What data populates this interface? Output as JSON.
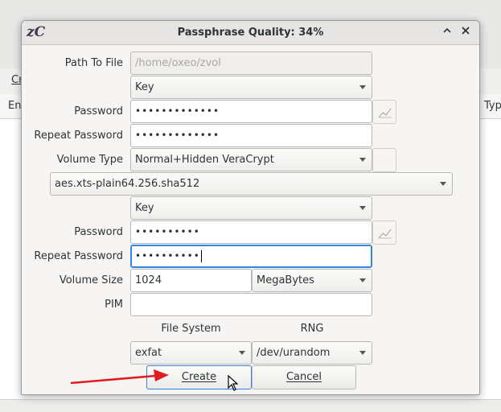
{
  "background": {
    "menu_partial": "Cr",
    "col_left_partial": "En",
    "col_right_partial": "Typ"
  },
  "dialog": {
    "app_logo": "zC",
    "title": "Passphrase Quality: 34%",
    "path_label": "Path To File",
    "path_placeholder": "/home/oxeo/zvol",
    "key_type_1": "Key",
    "password_label": "Password",
    "password_1_mask": "•••••••••••••",
    "repeat_password_label": "Repeat Password",
    "repeat_password_1_mask": "•••••••••••••",
    "volume_type_label": "Volume Type",
    "volume_type": "Normal+Hidden VeraCrypt",
    "algorithm": "aes.xts-plain64.256.sha512",
    "key_type_2": "Key",
    "password_2_mask": "••••••••••",
    "repeat_password_2_mask": "••••••••••",
    "volume_size_label": "Volume Size",
    "volume_size": "1024",
    "size_unit": "MegaBytes",
    "pim_label": "PIM",
    "pim_value": "",
    "file_system_label": "File System",
    "rng_label": "RNG",
    "file_system": "exfat",
    "rng": "/dev/urandom",
    "create_label": "Create",
    "cancel_label": "Cancel"
  },
  "colors": {
    "accent": "#3584e4",
    "annotation_arrow": "#e01b24"
  }
}
